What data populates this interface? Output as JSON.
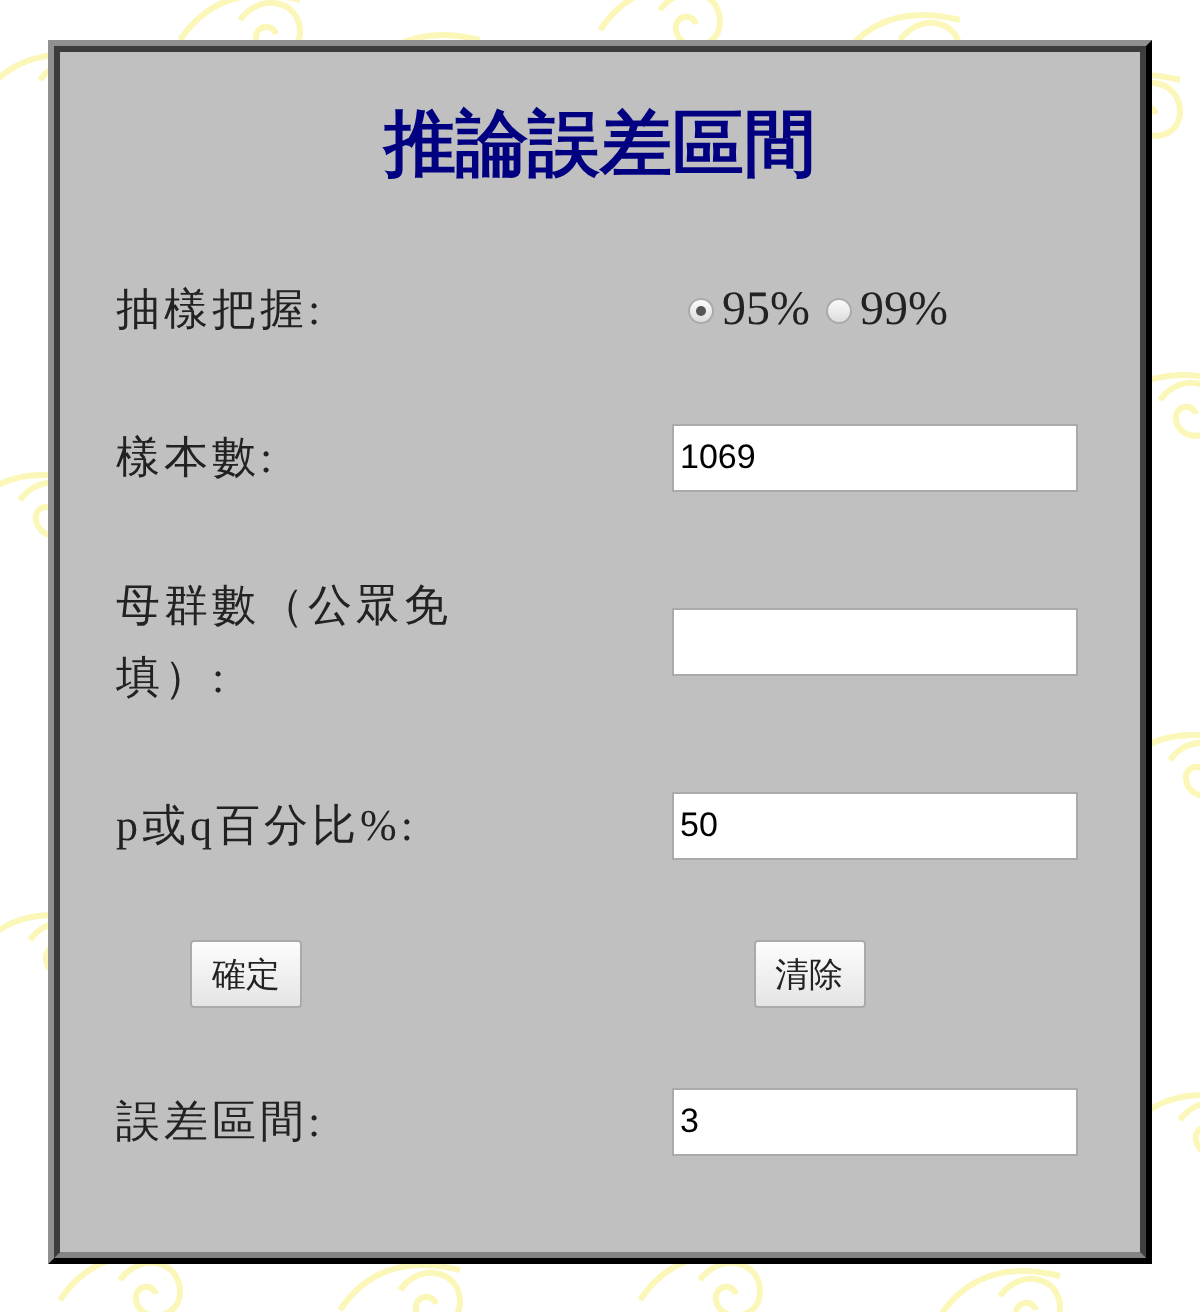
{
  "title": "推論誤差區間",
  "fields": [
    {
      "kind": "radio",
      "label": "抽樣把握:",
      "options": [
        {
          "label": "95%",
          "selected": true
        },
        {
          "label": "99%",
          "selected": false
        }
      ]
    },
    {
      "kind": "input",
      "label": "樣本數:",
      "value": "1069"
    },
    {
      "kind": "input",
      "label": "母群數（公眾免填）:"
    },
    {
      "kind": "input",
      "label": "p或q百分比%:",
      "value": "50"
    },
    {
      "kind": "buttons",
      "buttons": [
        "確定",
        "清除"
      ]
    },
    {
      "kind": "input",
      "label": "誤差區間:",
      "value": "3"
    }
  ]
}
